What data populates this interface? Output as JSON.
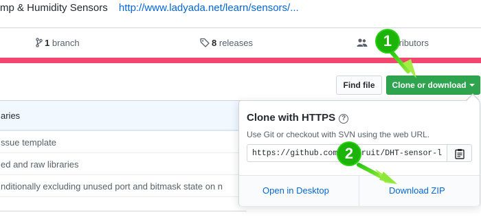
{
  "description": {
    "text": "mp & Humidity Sensors",
    "link": "http://www.ladyada.net/learn/sensors/..."
  },
  "stats": {
    "branch_count": "1",
    "branch_label": "branch",
    "releases_count": "8",
    "releases_label": "releases",
    "contributors_label": "tributors"
  },
  "language_bar_color": "#f1476f",
  "buttons": {
    "find_file": "Find file",
    "clone": "Clone or download"
  },
  "files": {
    "header": "aries",
    "rows": [
      "ssue template",
      "ed and raw libraries",
      "nditionally excluding unused port and bitmask state on n"
    ]
  },
  "dropdown": {
    "title": "Clone with HTTPS",
    "hint": "Use Git or checkout with SVN using the web URL.",
    "url": "https://github.com/adafruit/DHT-sensor-lib",
    "open_desktop": "Open in Desktop",
    "download_zip": "Download ZIP"
  },
  "annotations": {
    "step1": "1",
    "step2": "2",
    "color": "#1db40a"
  }
}
